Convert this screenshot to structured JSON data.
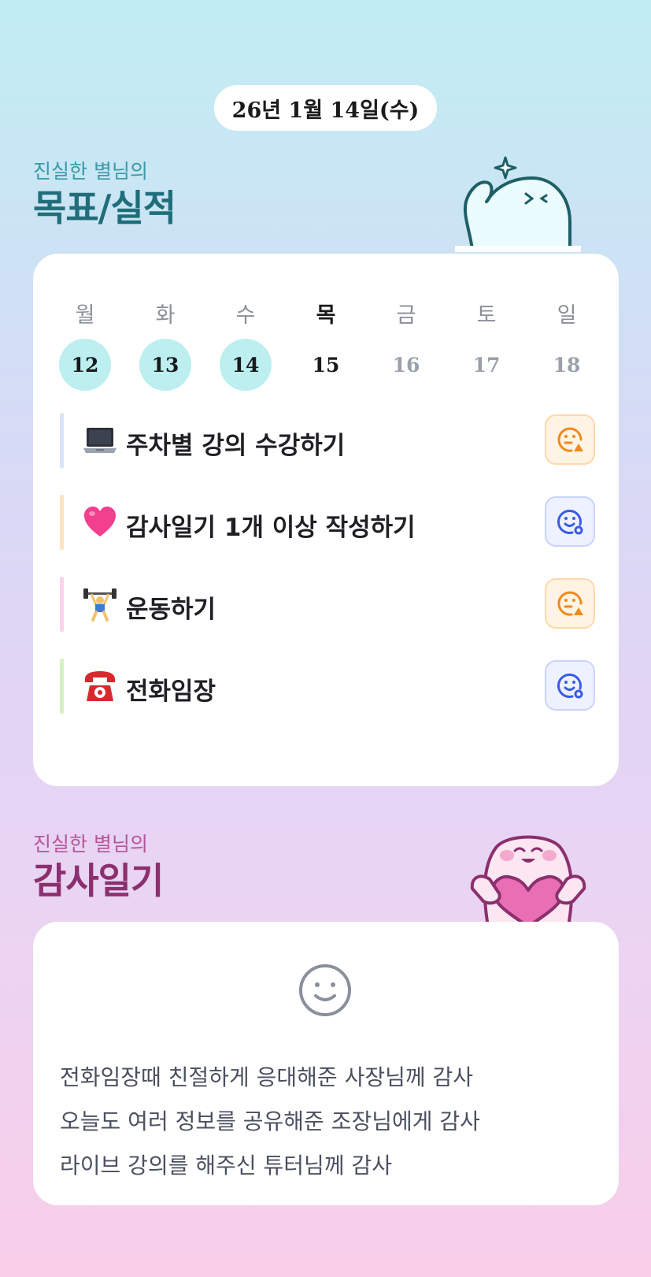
{
  "date_label": "26년 1월 14일(수)",
  "goals_section": {
    "subtitle": "진실한 별님의",
    "title": "목표/실적",
    "subtitle_color": "#3a9aa8",
    "title_color": "#1f6e7a"
  },
  "calendar": {
    "days": [
      {
        "dow": "월",
        "date": "12",
        "state": "past"
      },
      {
        "dow": "화",
        "date": "13",
        "state": "past"
      },
      {
        "dow": "수",
        "date": "14",
        "state": "past"
      },
      {
        "dow": "목",
        "date": "15",
        "state": "today"
      },
      {
        "dow": "금",
        "date": "16",
        "state": "future"
      },
      {
        "dow": "토",
        "date": "17",
        "state": "future"
      },
      {
        "dow": "일",
        "date": "18",
        "state": "future"
      }
    ],
    "highlight_color": "#bdeef0"
  },
  "goals": [
    {
      "emoji_icon": "laptop-icon",
      "text": "주차별 강의 수강하기",
      "bar_color": "#dbe3f7",
      "status": "partial",
      "status_icon": "neutral-warning-face-icon"
    },
    {
      "emoji_icon": "pink-heart-icon",
      "text": "감사일기 1개 이상 작성하기",
      "bar_color": "#fde2c4",
      "status": "done",
      "status_icon": "smile-face-icon"
    },
    {
      "emoji_icon": "weightlifter-icon",
      "text": "운동하기",
      "bar_color": "#fad3ec",
      "status": "partial",
      "status_icon": "neutral-warning-face-icon"
    },
    {
      "emoji_icon": "telephone-icon",
      "text": "전화임장",
      "bar_color": "#d7f2c2",
      "status": "done",
      "status_icon": "smile-face-icon"
    }
  ],
  "diary_section": {
    "subtitle": "진실한 별님의",
    "title": "감사일기",
    "subtitle_color": "#b5569a",
    "title_color": "#8c2f6e"
  },
  "diary": {
    "mood_icon": "smile-face-icon",
    "lines": [
      "전화임장때 친절하게 응대해준 사장님께 감사",
      "오늘도 여러 정보를 공유해준 조장님에게 감사",
      "라이브 강의를 해주신 튜터님께 감사"
    ]
  }
}
